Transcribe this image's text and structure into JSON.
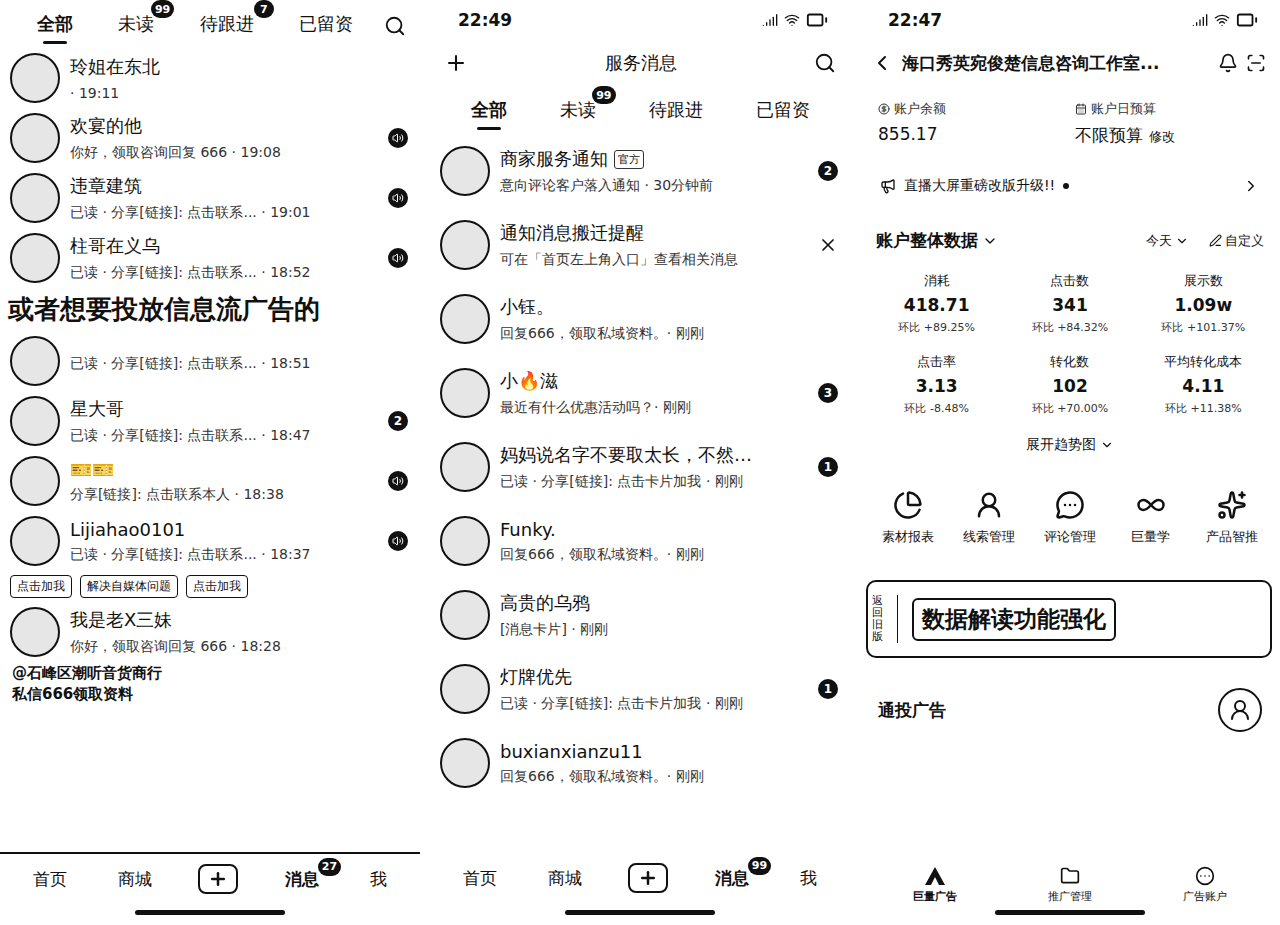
{
  "left_inbox": {
    "tabs": [
      {
        "label": "全部",
        "selected": true,
        "badge": ""
      },
      {
        "label": "未读",
        "selected": false,
        "badge": "99"
      },
      {
        "label": "待跟进",
        "selected": false,
        "badge": "7"
      },
      {
        "label": "已留资",
        "selected": false,
        "badge": ""
      }
    ],
    "items": [
      {
        "kind": "message",
        "name": "玲姐在东北",
        "preview": "· 19:11",
        "badge": "",
        "marked": false
      },
      {
        "kind": "message",
        "name": "欢宴的他",
        "preview": "你好，领取咨询回复 666 · 19:08",
        "badge": "",
        "marked": true
      },
      {
        "kind": "message",
        "name": "违章建筑",
        "preview": "已读 · 分享[链接]: 点击联系... · 19:01",
        "badge": "",
        "marked": true
      },
      {
        "kind": "message",
        "name": "柱哥在义乌",
        "preview": "已读 · 分享[链接]: 点击联系... · 18:52",
        "badge": "",
        "marked": true
      },
      {
        "kind": "caption",
        "texts": [
          "或者想要投放信息流广告的"
        ]
      },
      {
        "kind": "message",
        "name": "",
        "preview": "已读 · 分享[链接]: 点击联系... · 18:51",
        "badge": "",
        "marked": false
      },
      {
        "kind": "message",
        "name": "星大哥",
        "preview": "已读 · 分享[链接]: 点击联系... · 18:47",
        "badge": "2",
        "marked": false
      },
      {
        "kind": "message",
        "name": "🎫🎫",
        "preview": "分享[链接]: 点击联系本人 · 18:38",
        "badge": "",
        "marked": true
      },
      {
        "kind": "message",
        "name": "Lijiahao0101",
        "preview": "已读 · 分享[链接]: 点击联系... · 18:37",
        "badge": "",
        "marked": true
      },
      {
        "kind": "tags",
        "texts": [
          "点击加我",
          "解决自媒体问题",
          "点击加我"
        ]
      },
      {
        "kind": "message",
        "name": "我是老X三妹",
        "preview": "你好，领取咨询回复 666 · 18:28",
        "badge": "",
        "marked": false
      },
      {
        "kind": "author",
        "texts": [
          "@石峰区潮听音货商行",
          "私信666领取资料"
        ]
      }
    ],
    "nav": [
      {
        "kind": "tab",
        "label": "首页",
        "selected": false,
        "badge": ""
      },
      {
        "kind": "tab",
        "label": "商城",
        "selected": false,
        "badge": ""
      },
      {
        "kind": "plus",
        "label": "",
        "selected": false,
        "badge": ""
      },
      {
        "kind": "tab",
        "label": "消息",
        "selected": true,
        "badge": "27"
      },
      {
        "kind": "tab",
        "label": "我",
        "selected": false,
        "badge": ""
      }
    ]
  },
  "middle_inbox": {
    "status_time": "22:49",
    "title": "服务消息",
    "tabs": [
      {
        "label": "全部",
        "selected": true,
        "badge": ""
      },
      {
        "label": "未读",
        "selected": false,
        "badge": "99"
      },
      {
        "label": "待跟进",
        "selected": false,
        "badge": ""
      },
      {
        "label": "已留资",
        "selected": false,
        "badge": ""
      }
    ],
    "items": [
      {
        "name": "商家服务通知",
        "tag": "官方",
        "preview": "意向评论客户落入通知 · 30分钟前",
        "badge": "2",
        "closable": false
      },
      {
        "name": "通知消息搬迁提醒",
        "tag": "",
        "preview": "可在「首页左上角入口」查看相关消息",
        "badge": "",
        "closable": true
      },
      {
        "name": "小钰。",
        "tag": "",
        "preview": "回复666，领取私域资料。· 刚刚",
        "badge": "",
        "closable": false
      },
      {
        "name": "小🔥滋",
        "tag": "",
        "preview": "最近有什么优惠活动吗？· 刚刚",
        "badge": "3",
        "closable": false
      },
      {
        "name": "妈妈说名字不要取太长，不然…",
        "tag": "",
        "preview": "已读 · 分享[链接]: 点击卡片加我 · 刚刚",
        "badge": "1",
        "closable": false
      },
      {
        "name": "Funky.",
        "tag": "",
        "preview": "回复666，领取私域资料。· 刚刚",
        "badge": "",
        "closable": false
      },
      {
        "name": "高贵的乌鸦",
        "tag": "",
        "preview": "[消息卡片] · 刚刚",
        "badge": "",
        "closable": false
      },
      {
        "name": "灯牌优先",
        "tag": "",
        "preview": "已读 · 分享[链接]: 点击卡片加我 · 刚刚",
        "badge": "1",
        "closable": false
      },
      {
        "name": "buxianxianzu11",
        "tag": "",
        "preview": "回复666，领取私域资料。· 刚刚",
        "badge": "",
        "closable": false
      }
    ],
    "nav": [
      {
        "kind": "tab",
        "label": "首页",
        "selected": false,
        "badge": ""
      },
      {
        "kind": "tab",
        "label": "商城",
        "selected": false,
        "badge": ""
      },
      {
        "kind": "plus",
        "label": "",
        "selected": false,
        "badge": ""
      },
      {
        "kind": "tab",
        "label": "消息",
        "selected": true,
        "badge": "99"
      },
      {
        "kind": "tab",
        "label": "我",
        "selected": false,
        "badge": ""
      }
    ]
  },
  "ad_account": {
    "status_time": "22:47",
    "title": "海口秀英宛俊楚信息咨询工作室...",
    "balance": {
      "label": "账户余额",
      "value": "855.17"
    },
    "budget": {
      "label": "账户日预算",
      "value": "不限预算",
      "action": "修改"
    },
    "notice": {
      "text": "直播大屏重磅改版升级!!",
      "unread": true
    },
    "data_header": {
      "title": "账户整体数据",
      "range": "今天",
      "custom": "自定义"
    },
    "metrics": [
      {
        "label": "消耗",
        "value": "418.71",
        "change": "环比 +89.25%"
      },
      {
        "label": "点击数",
        "value": "341",
        "change": "环比 +84.32%"
      },
      {
        "label": "展示数",
        "value": "1.09w",
        "change": "环比 +101.37%"
      },
      {
        "label": "点击率",
        "value": "3.13",
        "change": "环比 -8.48%"
      },
      {
        "label": "转化数",
        "value": "102",
        "change": "环比 +70.00%"
      },
      {
        "label": "平均转化成本",
        "value": "4.11",
        "change": "环比 +11.38%"
      }
    ],
    "expand": "展开趋势图",
    "tools": [
      {
        "label": "素材报表"
      },
      {
        "label": "线索管理"
      },
      {
        "label": "评论管理"
      },
      {
        "label": "巨量学"
      },
      {
        "label": "产品智推"
      }
    ],
    "promo": {
      "side": "返回旧版",
      "text": "数据解读功能强化"
    },
    "section": "通投广告",
    "nav": [
      {
        "label": "巨量广告",
        "selected": true
      },
      {
        "label": "推广管理",
        "selected": false
      },
      {
        "label": "广告账户",
        "selected": false
      }
    ]
  }
}
